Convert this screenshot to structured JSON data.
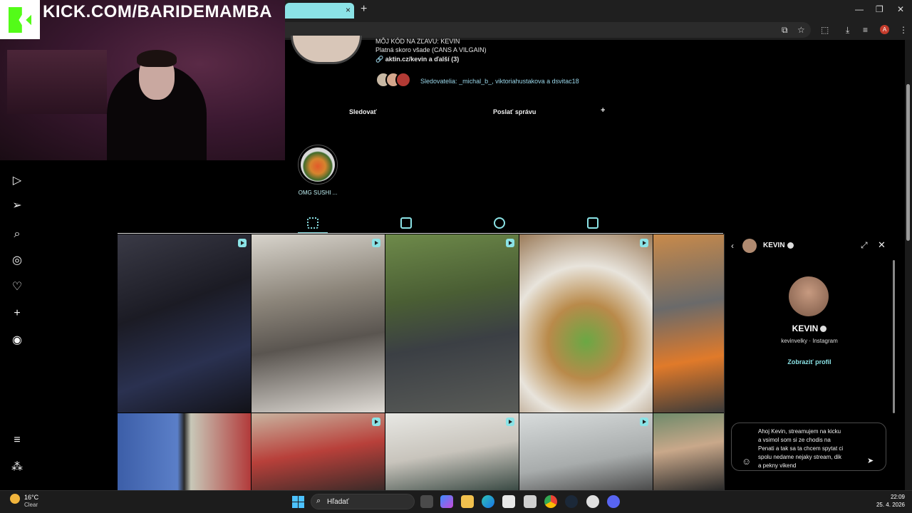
{
  "stream_overlay": {
    "url": "KICK.COM/BARIDEMAMBA"
  },
  "browser": {
    "tab_close": "×",
    "new_tab": "+",
    "profile_initial": "A"
  },
  "profile": {
    "bio_line_1": "MÔJ KÓD NA ZĽAVU: KEVIN",
    "bio_line_2": "Platná skoro všade (CANS A VILGAIN)",
    "link": "aktin.cz/kevin a ďalší (3)",
    "followers_label": "Sledovatelia:",
    "followers_names": "_michal_b_, viktoriahustakova a dsvitac18",
    "follow_button": "Sledovať",
    "message_button": "Poslať správu",
    "add_person_icon": "+",
    "highlight_label": "OMG SUSHI ..."
  },
  "chat": {
    "header_name": "KEVIN",
    "name": "KEVIN",
    "subtitle": "kevinvelky · Instagram",
    "profile_button": "Zobraziť profil",
    "message_draft": "Ahoj Kevin, streamujem na kicku\na vsimol som si ze chodis na\nPenati a tak sa ta chcem spytat ci\nspolu nedame nejaky stream, dik\na pekny vikend"
  },
  "taskbar": {
    "temperature": "16°C",
    "condition": "Clear",
    "search_placeholder": "Hľadať",
    "time": "22:09",
    "date": "25. 4. 2026"
  },
  "colors": {
    "accent": "#8be3e6",
    "kick_green": "#53fc18",
    "background": "#000000"
  }
}
